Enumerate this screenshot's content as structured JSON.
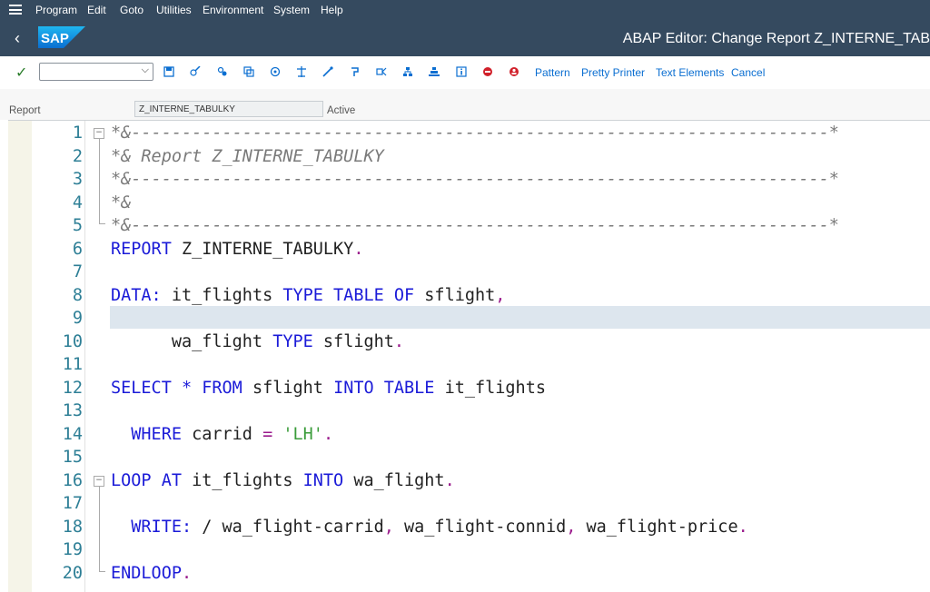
{
  "menu": [
    "Program",
    "Edit",
    "Goto",
    "Utilities",
    "Environment",
    "System",
    "Help"
  ],
  "title": "ABAP Editor: Change Report Z_INTERNE_TAB",
  "toolbar": {
    "pattern_label": "Pattern",
    "pretty_printer_label": "Pretty Printer",
    "text_elements_label": "Text Elements",
    "cancel_label": "Cancel",
    "icons": [
      "save-icon",
      "display-change-icon",
      "active-inactive-icon",
      "other-object-icon",
      "check-icon",
      "activate-icon",
      "test-icon",
      "where-used-icon",
      "navigation-window-icon",
      "display-object-list-icon",
      "enhancements-icon",
      "info-icon",
      "breakpoint-icon",
      "external-breakpoint-icon"
    ]
  },
  "report": {
    "label": "Report",
    "value": "Z_INTERNE_TABULKY",
    "status": "Active"
  },
  "editor": {
    "lines": [
      {
        "n": "1",
        "tokens": [
          [
            "c",
            "*&---------------------------------------------------------------------*"
          ]
        ]
      },
      {
        "n": "2",
        "tokens": [
          [
            "c",
            "*& "
          ],
          [
            "c",
            "Report Z_INTERNE_TABULKY"
          ]
        ]
      },
      {
        "n": "3",
        "tokens": [
          [
            "c",
            "*&---------------------------------------------------------------------*"
          ]
        ]
      },
      {
        "n": "4",
        "tokens": [
          [
            "c",
            "*&"
          ]
        ]
      },
      {
        "n": "5",
        "tokens": [
          [
            "c",
            "*&---------------------------------------------------------------------*"
          ]
        ]
      },
      {
        "n": "6",
        "tokens": [
          [
            "k",
            "REPORT"
          ],
          [
            "t",
            " Z_INTERNE_TABULKY"
          ],
          [
            "p",
            "."
          ]
        ]
      },
      {
        "n": "7",
        "tokens": []
      },
      {
        "n": "8",
        "tokens": [
          [
            "k",
            "DATA:"
          ],
          [
            "t",
            " it_flights "
          ],
          [
            "k",
            "TYPE TABLE OF"
          ],
          [
            "t",
            " sflight"
          ],
          [
            "p",
            ","
          ]
        ]
      },
      {
        "n": "9",
        "tokens": []
      },
      {
        "n": "10",
        "tokens": [
          [
            "t",
            "      wa_flight "
          ],
          [
            "k",
            "TYPE"
          ],
          [
            "t",
            " sflight"
          ],
          [
            "p",
            "."
          ]
        ]
      },
      {
        "n": "11",
        "tokens": []
      },
      {
        "n": "12",
        "tokens": [
          [
            "k",
            "SELECT"
          ],
          [
            "t",
            " "
          ],
          [
            "k",
            "*"
          ],
          [
            "t",
            " "
          ],
          [
            "k",
            "FROM"
          ],
          [
            "t",
            " sflight "
          ],
          [
            "k",
            "INTO TABLE"
          ],
          [
            "t",
            " it_flights"
          ]
        ]
      },
      {
        "n": "13",
        "tokens": []
      },
      {
        "n": "14",
        "tokens": [
          [
            "t",
            "  "
          ],
          [
            "k",
            "WHERE"
          ],
          [
            "t",
            " carrid "
          ],
          [
            "p",
            "="
          ],
          [
            "t",
            " "
          ],
          [
            "s",
            "'LH'"
          ],
          [
            "p",
            "."
          ]
        ]
      },
      {
        "n": "15",
        "tokens": []
      },
      {
        "n": "16",
        "tokens": [
          [
            "k",
            "LOOP AT"
          ],
          [
            "t",
            " it_flights "
          ],
          [
            "k",
            "INTO"
          ],
          [
            "t",
            " wa_flight"
          ],
          [
            "p",
            "."
          ]
        ]
      },
      {
        "n": "17",
        "tokens": []
      },
      {
        "n": "18",
        "tokens": [
          [
            "t",
            "  "
          ],
          [
            "k",
            "WRITE:"
          ],
          [
            "t",
            " / wa_flight-carrid"
          ],
          [
            "p",
            ","
          ],
          [
            "t",
            " wa_flight-connid"
          ],
          [
            "p",
            ","
          ],
          [
            "t",
            " wa_flight-price"
          ],
          [
            "p",
            "."
          ]
        ]
      },
      {
        "n": "19",
        "tokens": []
      },
      {
        "n": "20",
        "tokens": [
          [
            "k",
            "ENDLOOP"
          ],
          [
            "p",
            "."
          ]
        ]
      }
    ]
  },
  "colors": {
    "shell_bar": "#354a5f",
    "link": "#0a6ed1",
    "keyword": "#1b1bd8",
    "comment": "#7a7a7a",
    "string": "#3a9c3a",
    "punct": "#9b1b8c",
    "line_number": "#2e7f96",
    "current_line": "#dde6ee"
  }
}
